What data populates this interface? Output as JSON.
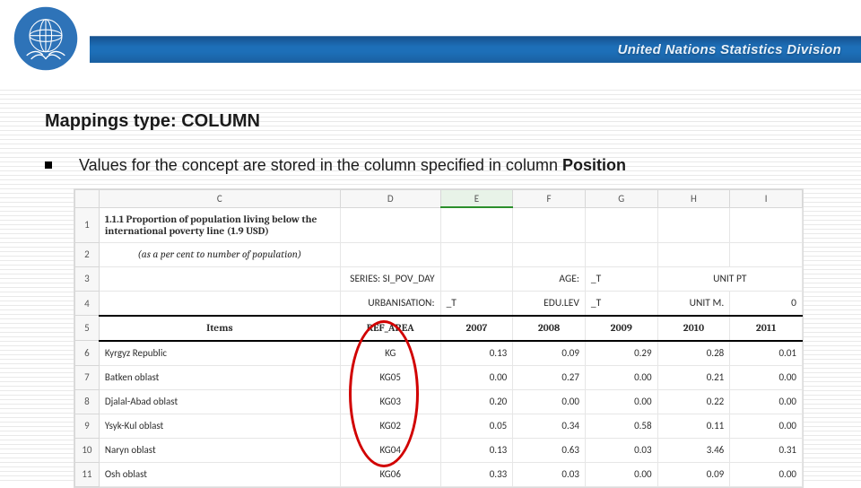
{
  "banner": {
    "org_title": "United Nations Statistics Division"
  },
  "slide": {
    "title": "Mappings type: COLUMN",
    "bullet_prefix": "Values for the concept are stored in the column specified in column ",
    "bullet_bold": "Position"
  },
  "sheet": {
    "col_letters": [
      "",
      "C",
      "D",
      "E",
      "F",
      "G",
      "H",
      "I"
    ],
    "selected_col_index": 3,
    "row_numbers": [
      "1",
      "2",
      "3",
      "4",
      "5",
      "6",
      "7",
      "8",
      "9",
      "10",
      "11"
    ],
    "r1_c": "1.1.1 Proportion of population living below the international poverty line (1.9 USD)",
    "r2_c": "(as a per cent to number of population)",
    "r3": {
      "D": "SERIES: SI_POV_DAY",
      "F": "AGE:",
      "G": "_T",
      "H_I": "UNIT PT"
    },
    "r4": {
      "D": "URBANISATION:",
      "E": "_T",
      "F": "EDU.LEV",
      "G": "_T",
      "H": "UNIT M.",
      "I": "0"
    },
    "r5": {
      "C": "Items",
      "D": "REF_AREA",
      "E": "2007",
      "F": "2008",
      "G": "2009",
      "H": "2010",
      "I": "2011"
    },
    "data": [
      {
        "C": "Kyrgyz Republic",
        "D": "KG",
        "E": "0.13",
        "F": "0.09",
        "G": "0.29",
        "H": "0.28",
        "I": "0.01"
      },
      {
        "C": "Batken oblast",
        "D": "KG05",
        "E": "0.00",
        "F": "0.27",
        "G": "0.00",
        "H": "0.21",
        "I": "0.00"
      },
      {
        "C": "Djalal-Abad oblast",
        "D": "KG03",
        "E": "0.20",
        "F": "0.00",
        "G": "0.00",
        "H": "0.22",
        "I": "0.00"
      },
      {
        "C": "Ysyk-Kul oblast",
        "D": "KG02",
        "E": "0.05",
        "F": "0.34",
        "G": "0.58",
        "H": "0.11",
        "I": "0.00"
      },
      {
        "C": "Naryn oblast",
        "D": "KG04",
        "E": "0.13",
        "F": "0.63",
        "G": "0.03",
        "H": "3.46",
        "I": "0.31"
      },
      {
        "C": "Osh oblast",
        "D": "KG06",
        "E": "0.33",
        "F": "0.03",
        "G": "0.00",
        "H": "0.09",
        "I": "0.00"
      }
    ]
  }
}
